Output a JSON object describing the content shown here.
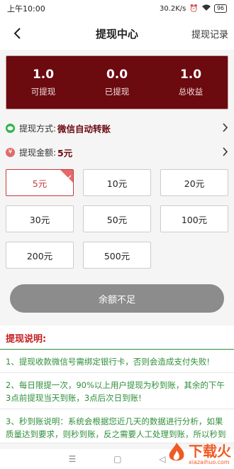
{
  "status_bar": {
    "time": "上午10:00",
    "network_speed": "30.2K/s",
    "battery": "96"
  },
  "nav": {
    "title": "提现中心",
    "right_label": "提现记录",
    "back_icon": "back-arrow-icon"
  },
  "summary": [
    {
      "value": "1.0",
      "label": "可提现"
    },
    {
      "value": "0.0",
      "label": "已提现"
    },
    {
      "value": "1.0",
      "label": "总收益"
    }
  ],
  "method_row": {
    "label": "提现方式:",
    "value": "微信自动转账",
    "icon": "wechat-icon",
    "color": "#2fb44b"
  },
  "amount_row": {
    "label": "提现金额:",
    "value": "5元",
    "icon": "yen-icon",
    "color": "#e06a6a"
  },
  "amounts": [
    "5元",
    "10元",
    "20元",
    "30元",
    "50元",
    "100元",
    "200元",
    "500元"
  ],
  "selected_amount_index": 0,
  "submit": {
    "label": "余额不足"
  },
  "description": {
    "title": "提现说明:",
    "items": [
      "1、提现收款微信号需绑定银行卡，否则会造成支付失败!",
      "2、每日限提一次，90%以上用户提现为秒到账，其余的下午3点前提现当天到账，3点后次日到账!",
      "3、秒到账说明：系统会根据您近几天的数据进行分析，如果质量达到要求，则秒到账，反之需要人工处理到账，所以秒到账"
    ]
  },
  "watermark": {
    "main": "下载火",
    "sub": "xiazaihuo.com"
  },
  "colors": {
    "accent": "#6b0a0f",
    "green": "#2f8f3a",
    "red": "#c41d1d"
  }
}
